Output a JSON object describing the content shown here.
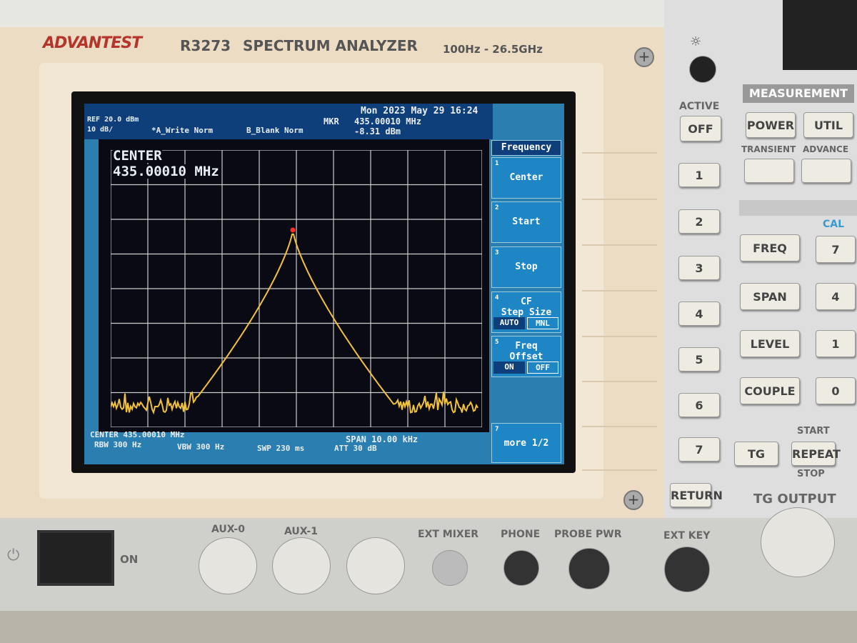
{
  "instrument": {
    "brand": "ADVANTEST",
    "model": "R3273",
    "title": "SPECTRUM ANALYZER",
    "range": "100Hz - 26.5GHz"
  },
  "screen": {
    "datetime": "Mon 2023 May 29 16:24",
    "ref": "REF 20.0 dBm",
    "scale": "10 dB/",
    "trace_a": "*A_Write Norm",
    "trace_b": "B_Blank Norm",
    "marker_label": "MKR",
    "marker_freq": "435.00010 MHz",
    "marker_level": "-8.31 dBm",
    "center_big_label": "CENTER",
    "center_big_value": "435.00010 MHz",
    "center": "CENTER 435.00010 MHz",
    "span": "SPAN 10.00 kHz",
    "rbw": "RBW 300 Hz",
    "vbw": "VBW 300 Hz",
    "swp": "SWP 230 ms",
    "att": "ATT 30 dB",
    "trace_color": "#f2c23a",
    "marker_color": "#ff3020"
  },
  "softkeys": {
    "title": "Frequency",
    "keys": [
      {
        "n": "1",
        "label": "Center"
      },
      {
        "n": "2",
        "label": "Start"
      },
      {
        "n": "3",
        "label": "Stop"
      },
      {
        "n": "4",
        "label": "CF\nStep Size",
        "opt1": "AUTO",
        "opt2": "MNL"
      },
      {
        "n": "5",
        "label": "Freq\nOffset",
        "opt1": "ON",
        "opt2": "OFF"
      },
      {
        "n": "7",
        "label": "more 1/2"
      }
    ]
  },
  "panel": {
    "active": "ACTIVE",
    "off": "OFF",
    "measurement": "MEASUREMENT",
    "power": "POWER",
    "util": "UTIL",
    "transient": "TRANSIENT",
    "advance": "ADVANCE",
    "cal": "CAL",
    "freq": "FREQ",
    "span": "SPAN",
    "level": "LEVEL",
    "couple": "COUPLE",
    "tg": "TG",
    "repeat": "REPEAT",
    "start": "START",
    "stop": "STOP",
    "return": "RETURN",
    "tg_output": "TG OUTPUT",
    "softnums": [
      "1",
      "2",
      "3",
      "4",
      "5",
      "6",
      "7"
    ],
    "numkeys": [
      "7",
      "4",
      "1",
      "0"
    ]
  },
  "bottom": {
    "on": "ON",
    "aux0": "AUX-0",
    "aux1": "AUX-1",
    "ext_mixer": "EXT MIXER",
    "phone": "PHONE",
    "probe_pwr": "PROBE PWR",
    "ext_key": "EXT KEY"
  }
}
